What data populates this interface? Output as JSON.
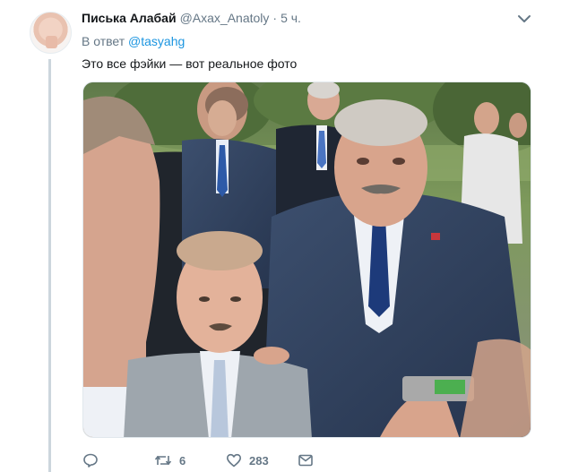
{
  "tweet": {
    "author_name": "Писька Алабай",
    "author_handle": "@Axax_Anatoly",
    "separator": "·",
    "time": "5 ч.",
    "reply_prefix": "В ответ",
    "reply_mention": "@tasyahg",
    "text": "Это все фэйки — вот реальное фото",
    "image_alt": "Photo of a group of men in suits outdoors"
  },
  "actions": {
    "reply_count": "",
    "retweet_count": "6",
    "like_count": "283"
  },
  "colors": {
    "link": "#1b95e0",
    "secondary_text": "#657786",
    "primary_text": "#14171a",
    "thread_line": "#ccd6dd"
  },
  "icons": {
    "reply": "speech-bubble-icon",
    "retweet": "retweet-arrows-icon",
    "like": "heart-icon",
    "dm": "envelope-icon",
    "menu": "chevron-down-icon"
  }
}
